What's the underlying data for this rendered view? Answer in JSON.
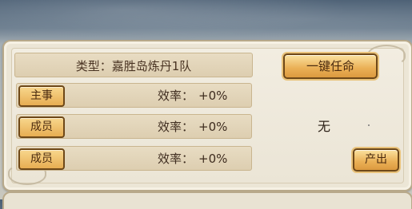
{
  "team": {
    "type_label": "类型：嘉胜岛炼丹1队"
  },
  "actions": {
    "appoint_label": "一键任命",
    "produce_label": "产出"
  },
  "members": [
    {
      "role": "主事",
      "efficiency_label": "效率：",
      "efficiency_value": "+0%"
    },
    {
      "role": "成员",
      "efficiency_label": "效率：",
      "efficiency_value": "+0%"
    },
    {
      "role": "成员",
      "efficiency_label": "效率：",
      "efficiency_value": "+0%"
    }
  ],
  "output": {
    "text": "无"
  }
}
